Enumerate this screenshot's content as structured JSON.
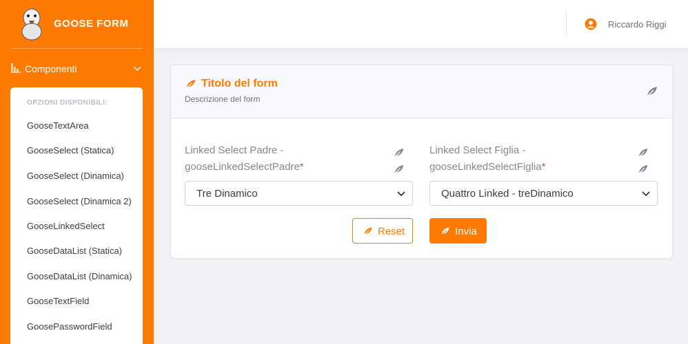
{
  "brand": {
    "name": "GOOSE FORM"
  },
  "sidebar": {
    "section_label": "Componenti",
    "submenu_heading": "OPZIONI DISPONIBILI:",
    "items": [
      {
        "label": "GooseTextArea"
      },
      {
        "label": "GooseSelect (Statica)"
      },
      {
        "label": "GooseSelect (Dinamica)"
      },
      {
        "label": "GooseSelect (Dinamica 2)"
      },
      {
        "label": "GooseLinkedSelect"
      },
      {
        "label": "GooseDataList (Statica)"
      },
      {
        "label": "GooseDataList (Dinamica)"
      },
      {
        "label": "GooseTextField"
      },
      {
        "label": "GoosePasswordField"
      }
    ]
  },
  "topbar": {
    "user_name": "Riccardo Riggi"
  },
  "card": {
    "title": "Titolo del form",
    "description": "Descrizione del form",
    "fields": [
      {
        "label_line1": "Linked Select Padre -",
        "label_line2": "gooseLinkedSelectPadre",
        "required_mark": "*",
        "selected": "Tre Dinamico"
      },
      {
        "label_line1": "Linked Select Figlia -",
        "label_line2": "gooseLinkedSelectFiglia",
        "required_mark": "*",
        "selected": "Quattro Linked - treDinamico"
      }
    ],
    "reset_label": "Reset",
    "submit_label": "Invia"
  },
  "colors": {
    "accent": "#ff7a00",
    "required": "#e74a3b",
    "muted_icon": "#858796"
  },
  "icons": {
    "nav_section": "chart-icon",
    "feather": "feather-icon",
    "user": "user-circle-icon",
    "chevron": "chevron-down-icon"
  }
}
